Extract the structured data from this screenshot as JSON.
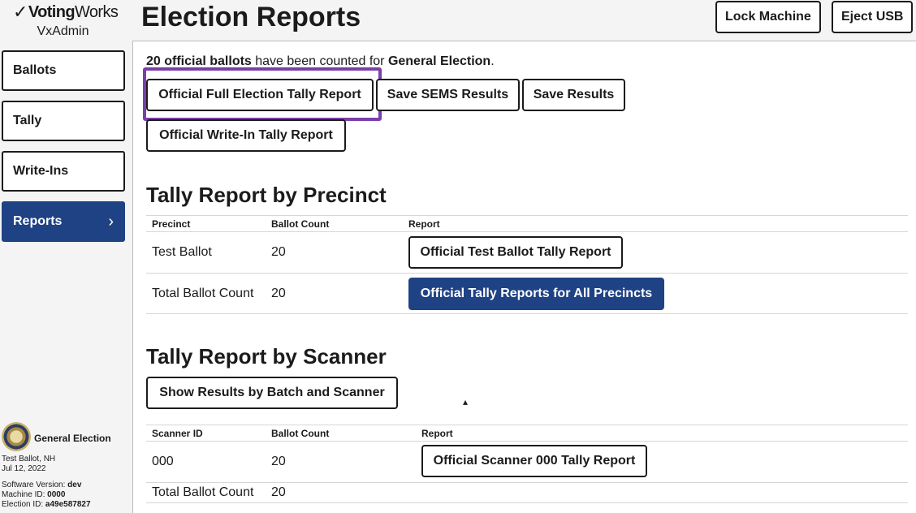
{
  "brand": {
    "logo_prefix": "Voting",
    "logo_suffix": "Works",
    "product": "VxAdmin"
  },
  "nav": [
    {
      "label": "Ballots",
      "active": false
    },
    {
      "label": "Tally",
      "active": false
    },
    {
      "label": "Write-Ins",
      "active": false
    },
    {
      "label": "Reports",
      "active": true
    }
  ],
  "election": {
    "title": "General Election",
    "location": "Test Ballot, NH",
    "date": "Jul 12, 2022",
    "software_version_label": "Software Version:",
    "software_version": "dev",
    "machine_id_label": "Machine ID:",
    "machine_id": "0000",
    "election_id_label": "Election ID:",
    "election_id": "a49e587827"
  },
  "header": {
    "title": "Election Reports",
    "lock_label": "Lock Machine",
    "eject_label": "Eject USB"
  },
  "summary": {
    "count_text": "20 official ballots",
    "middle_text": " have been counted for ",
    "election_name": "General Election",
    "end": "."
  },
  "actions": {
    "full_report": "Official Full Election Tally Report",
    "save_sems": "Save SEMS Results",
    "save_results": "Save Results",
    "write_in_report": "Official Write-In Tally Report"
  },
  "precinct_section": {
    "title": "Tally Report by Precinct",
    "headers": [
      "Precinct",
      "Ballot Count",
      "Report"
    ],
    "rows": [
      {
        "name": "Test Ballot",
        "count": "20",
        "button": "Official Test Ballot Tally Report"
      },
      {
        "name": "Total Ballot Count",
        "count": "20",
        "button": "Official Tally Reports for All Precincts"
      }
    ]
  },
  "scanner_section": {
    "title": "Tally Report by Scanner",
    "batch_button": "Show Results by Batch and Scanner",
    "headers": [
      "Scanner ID",
      "Ballot Count",
      "Report"
    ],
    "rows": [
      {
        "name": "000",
        "count": "20",
        "button": "Official Scanner 000 Tally Report"
      },
      {
        "name": "Total Ballot Count",
        "count": "20"
      }
    ]
  },
  "colors": {
    "primary": "#1f4284",
    "highlight": "#7b3fa9"
  }
}
